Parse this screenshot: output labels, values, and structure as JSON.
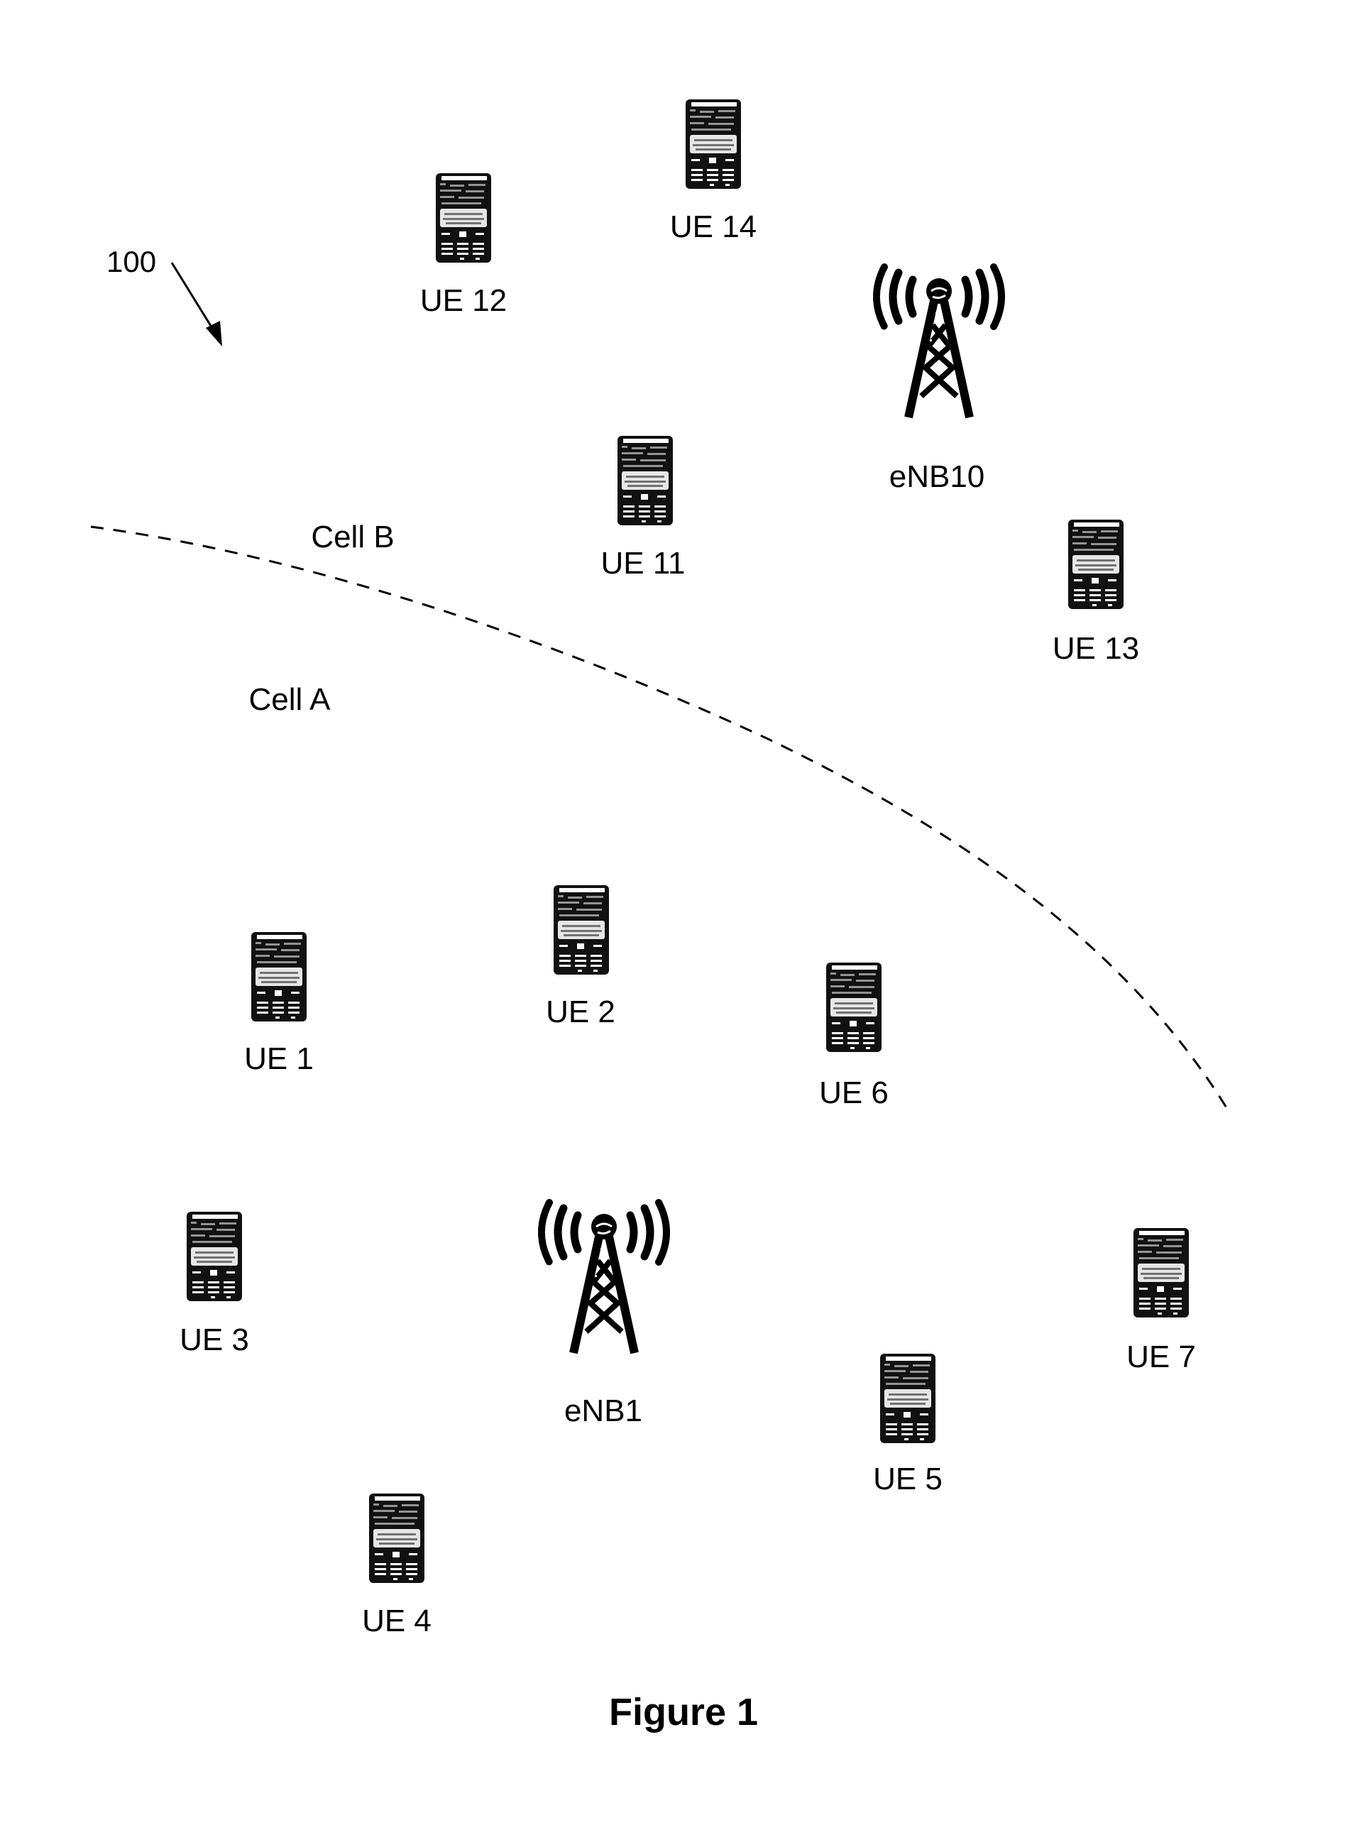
{
  "figure": {
    "caption": "Figure 1",
    "reference_numeral": "100",
    "cells": [
      {
        "id": "cell-b",
        "label": "Cell B"
      },
      {
        "id": "cell-a",
        "label": "Cell A"
      }
    ],
    "base_stations": [
      {
        "id": "enb10",
        "label": "eNB10",
        "cell": "Cell B",
        "icon": "cell-tower-icon"
      },
      {
        "id": "enb1",
        "label": "eNB1",
        "cell": "Cell A",
        "icon": "cell-tower-icon"
      }
    ],
    "user_equipment": [
      {
        "id": "ue12",
        "label": "UE 12",
        "cell": "Cell B",
        "icon": "mobile-phone-icon"
      },
      {
        "id": "ue14",
        "label": "UE 14",
        "cell": "Cell B",
        "icon": "mobile-phone-icon"
      },
      {
        "id": "ue11",
        "label": "UE 11",
        "cell": "Cell B",
        "icon": "mobile-phone-icon"
      },
      {
        "id": "ue13",
        "label": "UE 13",
        "cell": "Cell B",
        "icon": "mobile-phone-icon"
      },
      {
        "id": "ue1",
        "label": "UE 1",
        "cell": "Cell A",
        "icon": "mobile-phone-icon"
      },
      {
        "id": "ue2",
        "label": "UE 2",
        "cell": "Cell A",
        "icon": "mobile-phone-icon"
      },
      {
        "id": "ue6",
        "label": "UE 6",
        "cell": "Cell A",
        "icon": "mobile-phone-icon"
      },
      {
        "id": "ue3",
        "label": "UE 3",
        "cell": "Cell A",
        "icon": "mobile-phone-icon"
      },
      {
        "id": "ue7",
        "label": "UE 7",
        "cell": "Cell A",
        "icon": "mobile-phone-icon"
      },
      {
        "id": "ue5",
        "label": "UE 5",
        "cell": "Cell A",
        "icon": "mobile-phone-icon"
      },
      {
        "id": "ue4",
        "label": "UE 4",
        "cell": "Cell A",
        "icon": "mobile-phone-icon"
      }
    ],
    "boundary": {
      "style": "dashed",
      "separates": [
        "Cell A",
        "Cell B"
      ]
    },
    "colors": {
      "ink": "#000000",
      "background": "#ffffff"
    }
  }
}
